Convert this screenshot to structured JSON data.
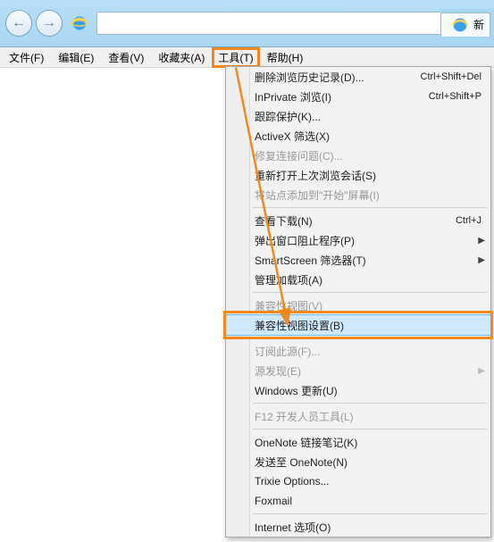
{
  "titlebar": {
    "back_icon": "←",
    "forward_icon": "→"
  },
  "tab": {
    "label": "新"
  },
  "menubar": {
    "file": "文件(F)",
    "edit": "编辑(E)",
    "view": "查看(V)",
    "fav": "收藏夹(A)",
    "tools": "工具(T)",
    "help": "帮助(H)"
  },
  "menu": {
    "delete_history": "删除浏览历史记录(D)...",
    "delete_history_sc": "Ctrl+Shift+Del",
    "inprivate": "InPrivate 浏览(I)",
    "inprivate_sc": "Ctrl+Shift+P",
    "tracking": "跟踪保护(K)...",
    "activex": "ActiveX 筛选(X)",
    "fix_conn": "修复连接问题(C)...",
    "reopen": "重新打开上次浏览会话(S)",
    "add_start": "将站点添加到\"开始\"屏幕(I)",
    "view_downloads": "查看下载(N)",
    "view_downloads_sc": "Ctrl+J",
    "popup": "弹出窗口阻止程序(P)",
    "smartscreen": "SmartScreen 筛选器(T)",
    "manage_addons": "管理加载项(A)",
    "compat_view": "兼容性视图(V)",
    "compat_settings": "兼容性视图设置(B)",
    "subscribe": "订阅此源(F)...",
    "feed_discover": "源发现(E)",
    "windows_update": "Windows 更新(U)",
    "f12": "F12 开发人员工具(L)",
    "onenote_link": "OneNote 链接笔记(K)",
    "send_onenote": "发送至 OneNote(N)",
    "trixie": "Trixie Options...",
    "foxmail": "Foxmail",
    "internet_options": "Internet 选项(O)"
  }
}
